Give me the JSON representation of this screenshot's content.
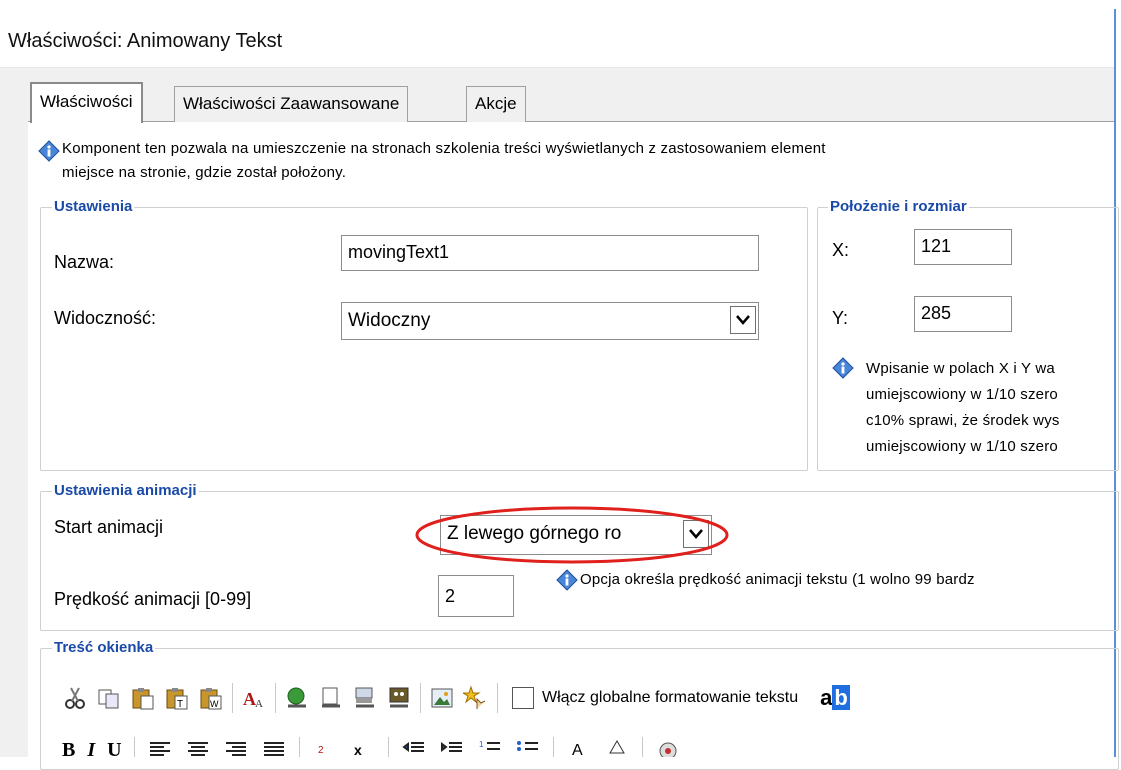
{
  "window": {
    "title": "Właściwości: Animowany Tekst"
  },
  "tabs": [
    {
      "label": "Właściwości",
      "active": true
    },
    {
      "label": "Właściwości Zaawansowane",
      "active": false
    },
    {
      "label": "Akcje",
      "active": false
    }
  ],
  "description": {
    "line1": "Komponent ten pozwala na umieszczenie na stronach szkolenia treści wyświetlanych z zastosowaniem element",
    "line2": "miejsce na stronie, gdzie został położony."
  },
  "settings": {
    "legend": "Ustawienia",
    "name_label": "Nazwa:",
    "name_value": "movingText1",
    "visibility_label": "Widoczność:",
    "visibility_value": "Widoczny"
  },
  "position": {
    "legend": "Położenie i rozmiar",
    "x_label": "X:",
    "x_value": "121",
    "y_label": "Y:",
    "y_value": "285",
    "hint_lines": [
      "Wpisanie w polach X i Y wa",
      "umiejscowiony w 1/10 szero",
      "c10% sprawi, że środek wys",
      "umiejscowiony w 1/10 szero"
    ]
  },
  "animation": {
    "legend": "Ustawienia animacji",
    "start_label": "Start animacji",
    "start_value": "Z lewego górnego ro",
    "speed_label": "Prędkość animacji [0-99]",
    "speed_value": "2",
    "speed_hint": "Opcja określa prędkość animacji tekstu (1 wolno 99 bardz"
  },
  "content": {
    "legend": "Treść okienka",
    "global_format_label": "Włącz globalne formatowanie tekstu",
    "global_format_checked": false,
    "toolbar_row1": [
      "cut-icon",
      "copy-icon",
      "paste-icon",
      "paste-text-icon",
      "paste-word-icon",
      "font-size-icon",
      "insert-link-icon",
      "link-page-icon",
      "link-file-icon",
      "link-action-icon",
      "insert-image-icon",
      "insert-special-icon"
    ],
    "toolbar_row2": [
      "bold-icon",
      "italic-icon",
      "underline-icon",
      "align-left-icon",
      "align-center-icon",
      "align-right-icon",
      "align-justify-icon",
      "subscript-icon",
      "superscript-icon",
      "outdent-icon",
      "indent-icon",
      "numbered-list-icon",
      "bullet-list-icon",
      "font-color-icon",
      "highlight-icon",
      "clean-icon"
    ],
    "format_sample": {
      "a": "a",
      "b": "b"
    },
    "format_labels": {
      "bold": "B",
      "italic": "I",
      "underline": "U"
    }
  },
  "colors": {
    "legend": "#1a4aa8",
    "highlight_ellipse": "#e0201c",
    "frame_accent": "#5b8fd6"
  }
}
